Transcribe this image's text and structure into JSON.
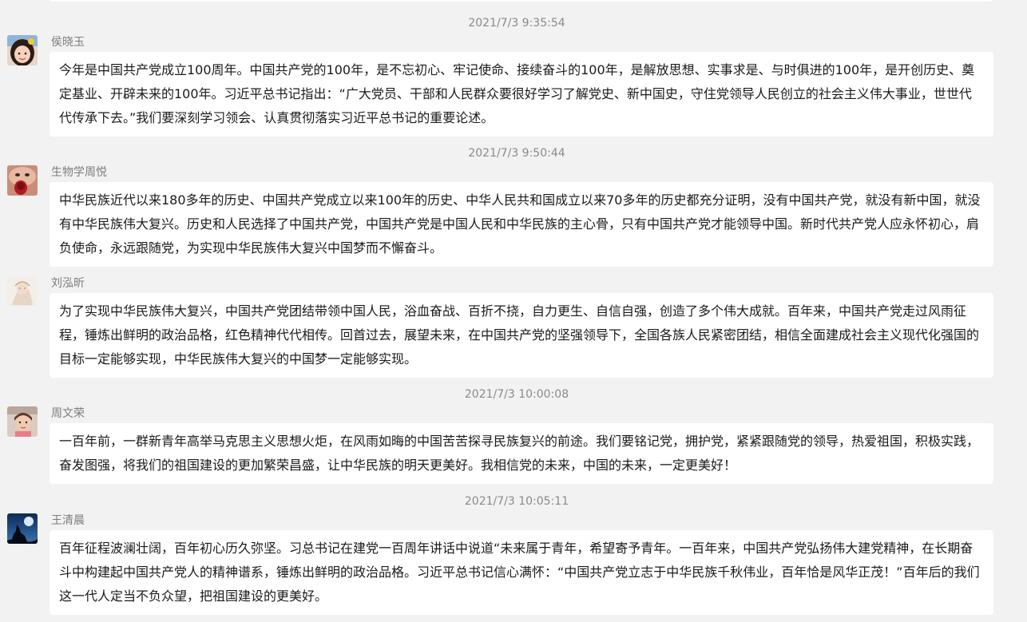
{
  "messages": [
    {
      "timestamp": "2021/7/3 9:35:54",
      "sender": "侯晓玉",
      "avatar_icon": "girl-portrait-avatar",
      "text": "今年是中国共产党成立100周年。中国共产党的100年，是不忘初心、牢记使命、接续奋斗的100年，是解放思想、实事求是、与时俱进的100年，是开创历史、奠定基业、开辟未来的100年。习近平总书记指出：“广大党员、干部和人民群众要很好学习了解党史、新中国史，守住党领导人民创立的社会主义伟大事业，世世代代传承下去。”我们要深刻学习领会、认真贯彻落实习近平总书记的重要论述。"
    },
    {
      "timestamp": "2021/7/3 9:50:44",
      "sender": "生物学周悦",
      "avatar_icon": "face-closeup-avatar",
      "text": "中华民族近代以来180多年的历史、中国共产党成立以来100年的历史、中华人民共和国成立以来70多年的历史都充分证明，没有中国共产党，就没有新中国，就没有中华民族伟大复兴。历史和人民选择了中国共产党，中国共产党是中国人民和中华民族的主心骨，只有中国共产党才能领导中国。新时代共产党人应永怀初心，肩负使命，永远跟随党，为实现中华民族伟大复兴中国梦而不懈奋斗。"
    },
    {
      "timestamp": "",
      "sender": "刘泓昕",
      "avatar_icon": "pale-sketch-avatar",
      "text": "为了实现中华民族伟大复兴，中国共产党团结带领中国人民，浴血奋战、百折不挠，自力更生、自信自强，创造了多个伟大成就。百年来，中国共产党走过风雨征程，锤炼出鲜明的政治品格，红色精神代代相传。回首过去，展望未来，在中国共产党的坚强领导下，全国各族人民紧密团结，相信全面建成社会主义现代化强国的目标一定能够实现，中华民族伟大复兴的中国梦一定能够实现。"
    },
    {
      "timestamp": "2021/7/3 10:00:08",
      "sender": "周文荣",
      "avatar_icon": "child-photo-avatar",
      "text": "一百年前，一群新青年高举马克思主义思想火炬，在风雨如晦的中国苦苦探寻民族复兴的前途。我们要铭记党，拥护党，紧紧跟随党的领导，热爱祖国，积极实践，奋发图强，将我们的祖国建设的更加繁荣昌盛，让中华民族的明天更美好。我相信党的未来，中国的未来，一定更美好！"
    },
    {
      "timestamp": "2021/7/3 10:05:11",
      "sender": "王清晨",
      "avatar_icon": "howling-wolf-avatar",
      "text": "百年征程波澜壮阔，百年初心历久弥坚。习总书记在建党一百周年讲话中说道“未来属于青年，希望寄予青年。一百年来，中国共产党弘扬伟大建党精神，在长期奋斗中构建起中国共产党人的精神谱系，锤炼出鲜明的政治品格。习近平总书记信心满怀：“中国共产党立志于中华民族千秋伟业，百年恰是风华正茂！”百年后的我们这一代人定当不负众望，把祖国建设的更美好。"
    }
  ]
}
